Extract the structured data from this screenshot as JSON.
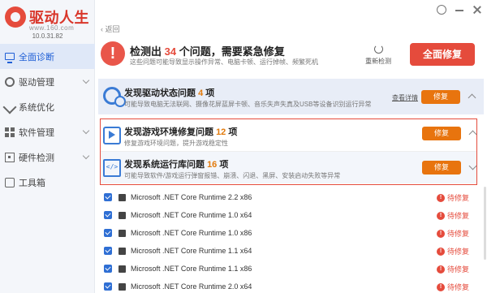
{
  "app": {
    "title": "驱动人生",
    "url": "www.160.com",
    "version": "10.0.31.82"
  },
  "sidebar": {
    "items": [
      {
        "label": "全面诊断",
        "icon": "monitor-icon"
      },
      {
        "label": "驱动管理",
        "icon": "gear-icon"
      },
      {
        "label": "系统优化",
        "icon": "rocket-icon"
      },
      {
        "label": "软件管理",
        "icon": "apps-grid-icon"
      },
      {
        "label": "硬件检测",
        "icon": "chip-icon"
      },
      {
        "label": "工具箱",
        "icon": "toolbox-icon"
      }
    ]
  },
  "header": {
    "back_label": "返回",
    "title_prefix": "检测出",
    "issue_count": "34",
    "title_suffix": "个问题，需要紧急修复",
    "subtitle": "这些问题可能导致显示操作异常、电脑卡顿、运行掉帧、频繁死机",
    "rescan_label": "重新检测",
    "fix_all_label": "全面修复"
  },
  "sections": {
    "driver": {
      "title_prefix": "发现驱动状态问题",
      "count": "4",
      "unit": "项",
      "desc": "可能导致电脑无法联网、摄像花屏蓝屏卡顿、音乐失声失真及USB等设备识别运行异常",
      "view_label": "查看详情",
      "fix_label": "修复"
    },
    "game": {
      "title_prefix": "发现游戏环境修复问题",
      "count": "12",
      "unit": "项",
      "desc": "修复游戏环境问题，提升游戏稳定性",
      "fix_label": "修复"
    },
    "runtime": {
      "title_prefix": "发现系统运行库问题",
      "count": "16",
      "unit": "项",
      "desc": "可能导致软件/游戏运行弹窗报错、崩溃、闪退、黑屏、安装启动失败等异常",
      "fix_label": "修复"
    }
  },
  "list": {
    "status_label": "待修复",
    "items": [
      "Microsoft .NET Core Runtime 2.2 x86",
      "Microsoft .NET Core Runtime 1.0 x64",
      "Microsoft .NET Core Runtime 1.0 x86",
      "Microsoft .NET Core Runtime 1.1 x64",
      "Microsoft .NET Core Runtime 1.1 x86",
      "Microsoft .NET Core Runtime 2.0 x64"
    ]
  },
  "colors": {
    "brand_red": "#e54b3c",
    "fix_orange": "#e8740e",
    "accent_blue": "#1f5fd6"
  }
}
